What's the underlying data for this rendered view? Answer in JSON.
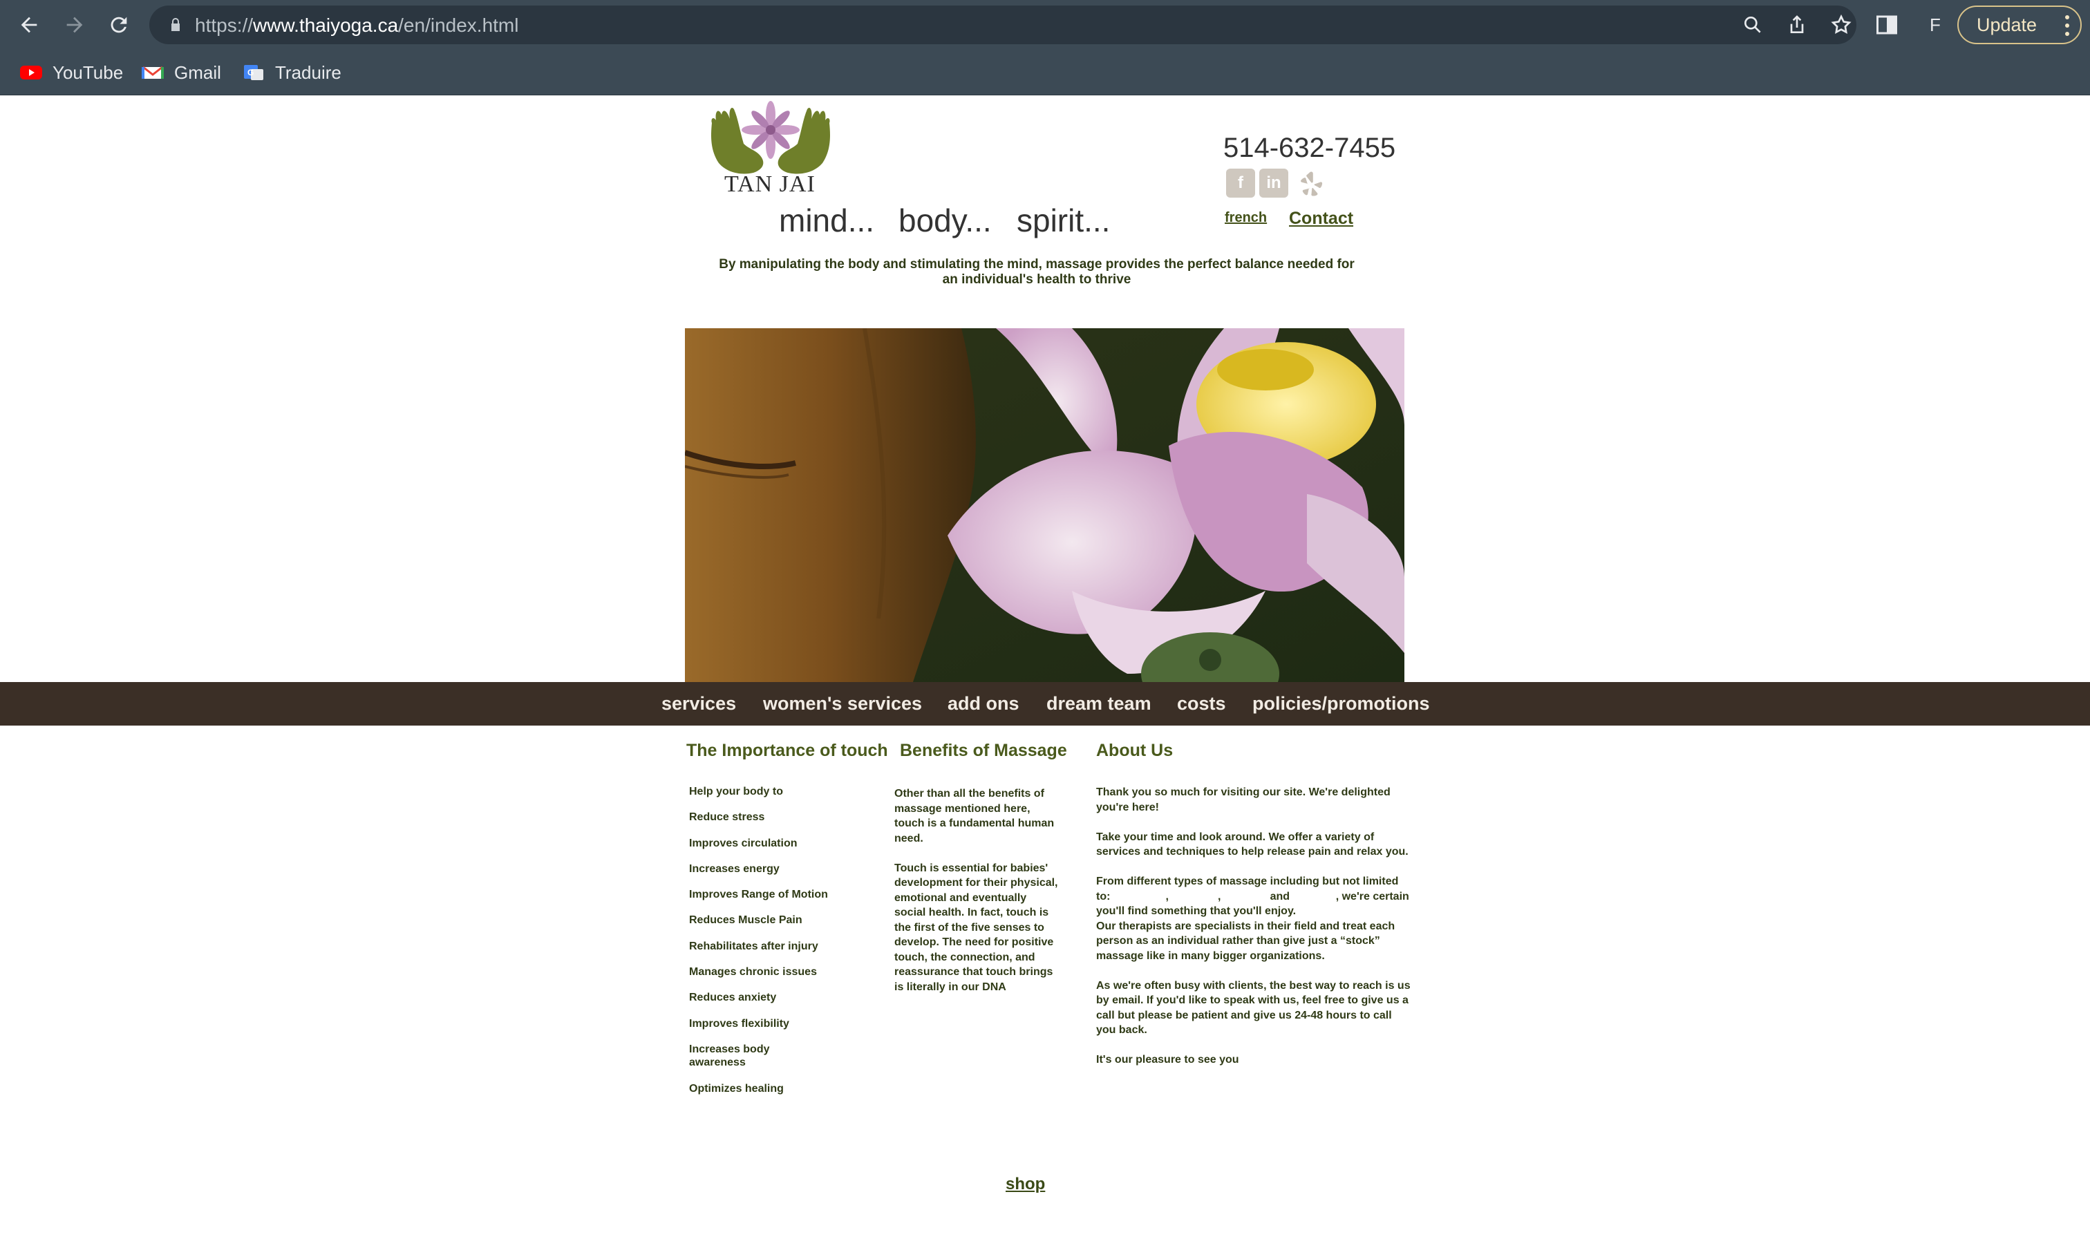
{
  "browser": {
    "url_scheme": "https://",
    "url_host": "www.thaiyoga.ca",
    "url_path": "/en/index.html",
    "profile_initial": "F",
    "update_label": "Update",
    "bookmarks": [
      {
        "label": "YouTube",
        "icon": "youtube-icon"
      },
      {
        "label": "Gmail",
        "icon": "gmail-icon"
      },
      {
        "label": "Traduire",
        "icon": "translate-icon"
      }
    ]
  },
  "header": {
    "logo_text": "TAN JAI",
    "tagline": [
      "mind...",
      "body...",
      "spirit..."
    ],
    "phone": "514-632-7455",
    "social": [
      {
        "name": "facebook",
        "glyph": "f"
      },
      {
        "name": "linkedin",
        "glyph": "in"
      },
      {
        "name": "yelp",
        "glyph": ""
      }
    ],
    "language_link": "french",
    "contact_link": "Contact",
    "intro": "By manipulating the body and stimulating the mind, massage provides the perfect balance needed for an individual's health to thrive"
  },
  "menu": [
    "services",
    "women's services",
    "add ons",
    "dream team",
    "costs",
    "policies/promotions"
  ],
  "columns": {
    "touch": {
      "heading": "The Importance of touch",
      "items": [
        "Help your body to",
        "Reduce stress",
        "Improves circulation",
        "Increases energy",
        "Improves Range of Motion",
        "Reduces Muscle Pain",
        "Rehabilitates after injury",
        "Manages chronic issues",
        "Reduces anxiety",
        "Improves flexibility",
        "Increases body awareness",
        "Optimizes healing"
      ]
    },
    "benefits": {
      "heading": "Benefits of Massage",
      "paragraphs": [
        "Other than all the benefits of massage mentioned here, touch is a fundamental human need.",
        "Touch is essential for babies' development for their physical, emotional and eventually social health. In fact, touch is the first of the five senses to develop. The need for positive touch, the connection, and reassurance that touch brings is literally in our DNA"
      ]
    },
    "about": {
      "heading": "About Us",
      "paragraphs": [
        "Thank you so much for visiting our site. We're delighted you're here!",
        "Take your time and look around.  We offer a variety of services and techniques to help release pain and relax you.",
        "From different types of massage including but not limited to:                  ,                ,                and               , we're certain you'll find something that you'll enjoy.",
        "Our therapists are specialists in their field and treat each person as an individual rather than give just a “stock” massage like in many bigger organizations.",
        "As we're often busy with clients, the best way to reach is us by email. If you'd like to speak with us, feel free to give us a call but please be patient and give us 24-48 hours to call you back.",
        "It's our pleasure to see you"
      ]
    }
  },
  "footer": {
    "shop_link": "shop"
  },
  "colors": {
    "browser_chrome": "#3c4a55",
    "menu_bar": "#3b2f26",
    "heading_green": "#4a5a1c",
    "text_dark_green": "#2f3a16"
  }
}
